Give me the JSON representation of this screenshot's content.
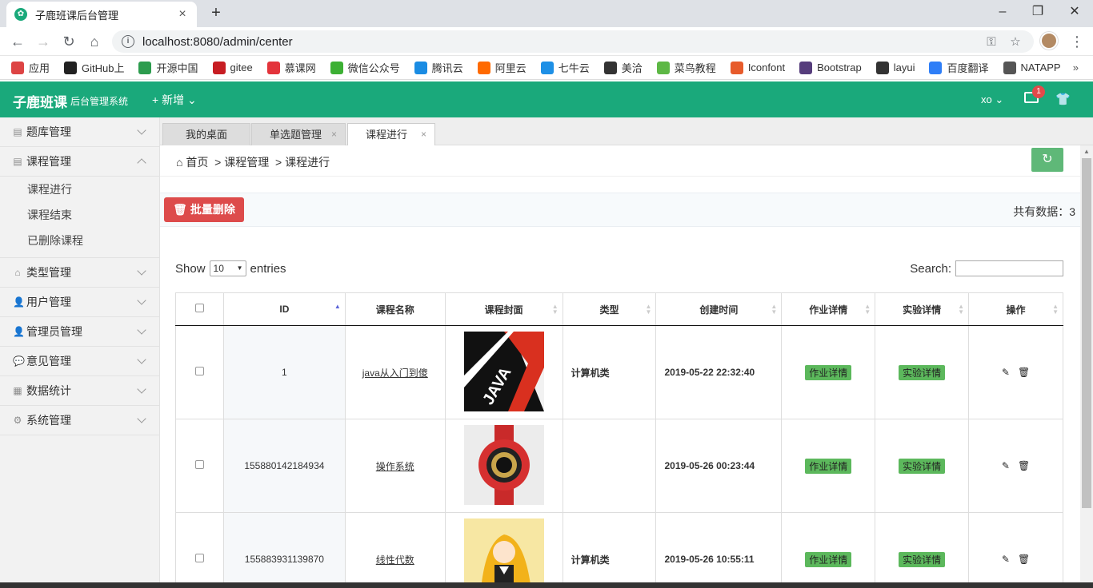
{
  "browser": {
    "tab_title": "子鹿班课后台管理",
    "url": "localhost:8080/admin/center",
    "bookmarks": [
      {
        "label": "应用",
        "color": "#d44"
      },
      {
        "label": "GitHub上",
        "color": "#222"
      },
      {
        "label": "开源中国",
        "color": "#2c9c4e"
      },
      {
        "label": "gitee",
        "color": "#c71d23"
      },
      {
        "label": "慕课网",
        "color": "#e3343b"
      },
      {
        "label": "微信公众号",
        "color": "#3cb034"
      },
      {
        "label": "腾讯云",
        "color": "#1a8ce3"
      },
      {
        "label": "阿里云",
        "color": "#ff6a00"
      },
      {
        "label": "七牛云",
        "color": "#1e90e6"
      },
      {
        "label": "美洽",
        "color": "#333"
      },
      {
        "label": "菜鸟教程",
        "color": "#5db845"
      },
      {
        "label": "Iconfont",
        "color": "#e75b2b"
      },
      {
        "label": "Bootstrap",
        "color": "#563d7c"
      },
      {
        "label": "layui",
        "color": "#333"
      },
      {
        "label": "百度翻译",
        "color": "#2e7ef7"
      },
      {
        "label": "NATAPP",
        "color": "#555"
      }
    ]
  },
  "header": {
    "logo": "子鹿班课",
    "subtitle": "后台管理系统",
    "add_new": "+ 新增",
    "user": "xo",
    "mail_badge": "1",
    "accent": "#1aa97b"
  },
  "sidebar": {
    "items": [
      {
        "label": "题库管理",
        "icon": "list-icon"
      },
      {
        "label": "课程管理",
        "icon": "list-icon",
        "expanded": true,
        "children": [
          "课程进行",
          "课程结束",
          "已删除课程"
        ]
      },
      {
        "label": "类型管理",
        "icon": "briefcase-icon"
      },
      {
        "label": "用户管理",
        "icon": "user-icon"
      },
      {
        "label": "管理员管理",
        "icon": "user-icon"
      },
      {
        "label": "意见管理",
        "icon": "comment-icon"
      },
      {
        "label": "数据统计",
        "icon": "chart-icon"
      },
      {
        "label": "系统管理",
        "icon": "gear-icon"
      }
    ]
  },
  "page_tabs": [
    "我的桌面",
    "单选题管理",
    "课程进行"
  ],
  "breadcrumb": {
    "home": "首页",
    "level1": "课程管理",
    "level2": "课程进行"
  },
  "toolbar": {
    "delete_label": "批量删除",
    "total_label": "共有数据：3"
  },
  "datatable": {
    "show": "Show",
    "entries_value": "10",
    "entries": "entries",
    "search": "Search:",
    "columns": [
      "ID",
      "课程名称",
      "课程封面",
      "类型",
      "创建时间",
      "作业详情",
      "实验详情",
      "操作"
    ],
    "rows": [
      {
        "id": "1",
        "name": "java从入门到傻",
        "cover": "java-book-cover",
        "type": "计算机类",
        "created": "2019-05-22 22:32:40",
        "homework": "作业详情",
        "experiment": "实验详情"
      },
      {
        "id": "155880142184934",
        "name": "操作系统",
        "cover": "red-watch",
        "type": "",
        "created": "2019-05-26 00:23:44",
        "homework": "作业详情",
        "experiment": "实验详情"
      },
      {
        "id": "155883931139870",
        "name": "线性代数",
        "cover": "anime-girl",
        "type": "计算机类",
        "created": "2019-05-26 10:55:11",
        "homework": "作业详情",
        "experiment": "实验详情"
      }
    ]
  }
}
